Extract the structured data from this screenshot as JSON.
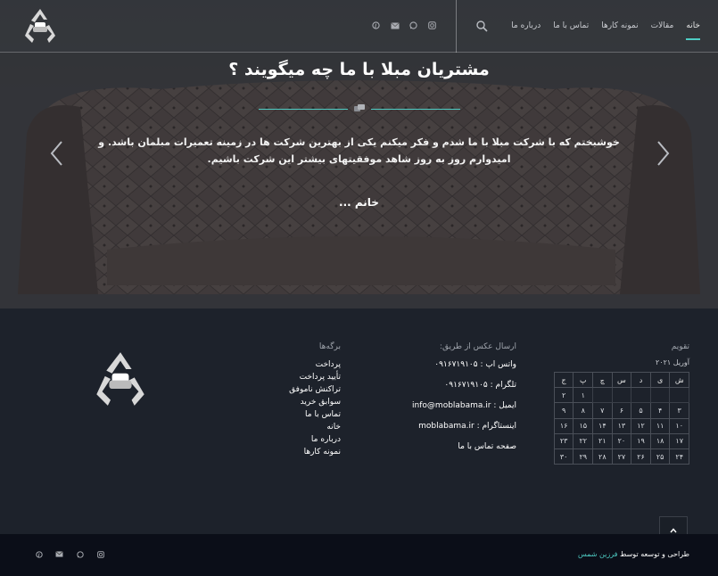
{
  "nav": {
    "items": [
      "خانه",
      "مقالات",
      "نمونه کارها",
      "تماس با ما",
      "درباره ما"
    ],
    "active_index": 0
  },
  "social_icons": [
    "pinterest-icon",
    "email-icon",
    "whatsapp-icon",
    "instagram-icon"
  ],
  "testimonials": {
    "title": "مشتریان مبلا با ما چه میگویند ؟",
    "quote": "خوشبختم که با شرکت مبلا با ما شدم و فکر میکنم یکی از بهترین شرکت ها در زمینه تعمیرات مبلمان باشد. و امیدوارم روز به روز شاهد موفقیتهای بیشتر این شرکت باشیم.",
    "author": "خانم ..."
  },
  "footer": {
    "calendar": {
      "title": "تقویم",
      "month": "آوریل ۲۰۲۱",
      "weekdays": [
        "ش",
        "ی",
        "د",
        "س",
        "چ",
        "پ",
        "ج"
      ],
      "weeks": [
        [
          "",
          "",
          "",
          "",
          "",
          "۱",
          "۲"
        ],
        [
          "۳",
          "۴",
          "۵",
          "۶",
          "۷",
          "۸",
          "۹"
        ],
        [
          "۱۰",
          "۱۱",
          "۱۲",
          "۱۳",
          "۱۴",
          "۱۵",
          "۱۶"
        ],
        [
          "۱۷",
          "۱۸",
          "۱۹",
          "۲۰",
          "۲۱",
          "۲۲",
          "۲۳"
        ],
        [
          "۲۴",
          "۲۵",
          "۲۶",
          "۲۷",
          "۲۸",
          "۲۹",
          "۳۰"
        ]
      ]
    },
    "contact": {
      "title": "ارسال عکس از طریق:",
      "items": [
        {
          "label": "واتس اپ : ",
          "value": "۰۹۱۶۷۱۹۱۰۵"
        },
        {
          "label": "تلگرام : ",
          "value": "۰۹۱۶۷۱۹۱۰۵"
        },
        {
          "label": "ایمیل : ",
          "value": "info@moblabama.ir"
        },
        {
          "label": "اینستاگرام : ",
          "value": "moblabama.ir"
        },
        {
          "label": "صفحه تماس با ما",
          "value": ""
        }
      ]
    },
    "pages": {
      "title": "برگه‌ها",
      "items": [
        "پرداخت",
        "تأیید پرداخت",
        "تراکنش ناموفق",
        "سوابق خرید",
        "تماس با ما",
        "خانه",
        "درباره ما",
        "نمونه کارها"
      ]
    }
  },
  "bottom": {
    "credit_prefix": "طراحی و توسعه توسط ",
    "credit_name": "فرزین شمس"
  },
  "colors": {
    "accent": "#4ecdc4",
    "footer_bg": "#1d222b",
    "bottombar_bg": "#0b0e18"
  }
}
